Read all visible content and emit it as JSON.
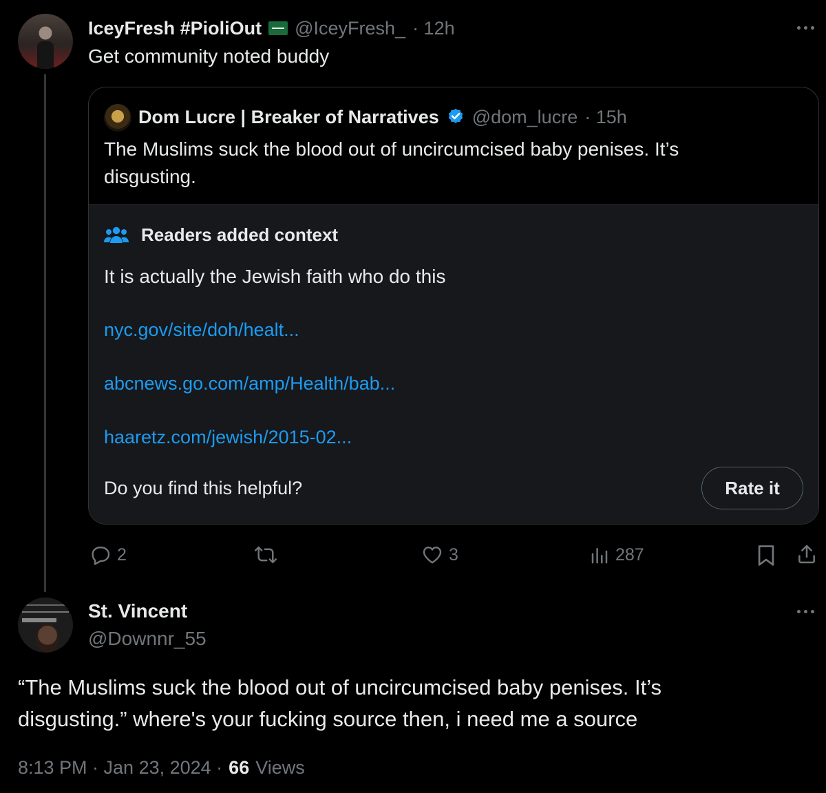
{
  "reply1": {
    "display_name": "IceyFresh #PioliOut",
    "flag_icon": "saudi-flag",
    "handle": "@IceyFresh_",
    "time": "· 12h",
    "text": "Get community noted buddy"
  },
  "quoted": {
    "display_name": "Dom Lucre | Breaker of Narratives",
    "handle": "@dom_lucre",
    "time": "· 15h",
    "text": "The Muslims suck the blood out of uncircumcised baby penises. It’s disgusting."
  },
  "context": {
    "heading": "Readers added context",
    "body": "It is actually the Jewish faith who do this",
    "links": [
      "nyc.gov/site/doh/healt...",
      "abcnews.go.com/amp/Health/bab...",
      "haaretz.com/jewish/2015-02..."
    ],
    "question": "Do you find this helpful?",
    "rate_label": "Rate it"
  },
  "actions": {
    "replies": "2",
    "likes": "3",
    "views": "287"
  },
  "main": {
    "display_name": "St. Vincent",
    "handle": "@Downnr_55",
    "text": "“The Muslims suck the blood out of uncircumcised baby penises. It’s disgusting.” where's your fucking source then, i need me a source",
    "timestamp": "8:13 PM · Jan 23, 2024 ·",
    "views_count": "66",
    "views_label": "Views"
  },
  "colors": {
    "background": "#000000",
    "text": "#e7e9ea",
    "secondary": "#71767b",
    "link": "#1d9bf0",
    "verified": "#1d9bf0",
    "context_bg": "#16181c"
  }
}
